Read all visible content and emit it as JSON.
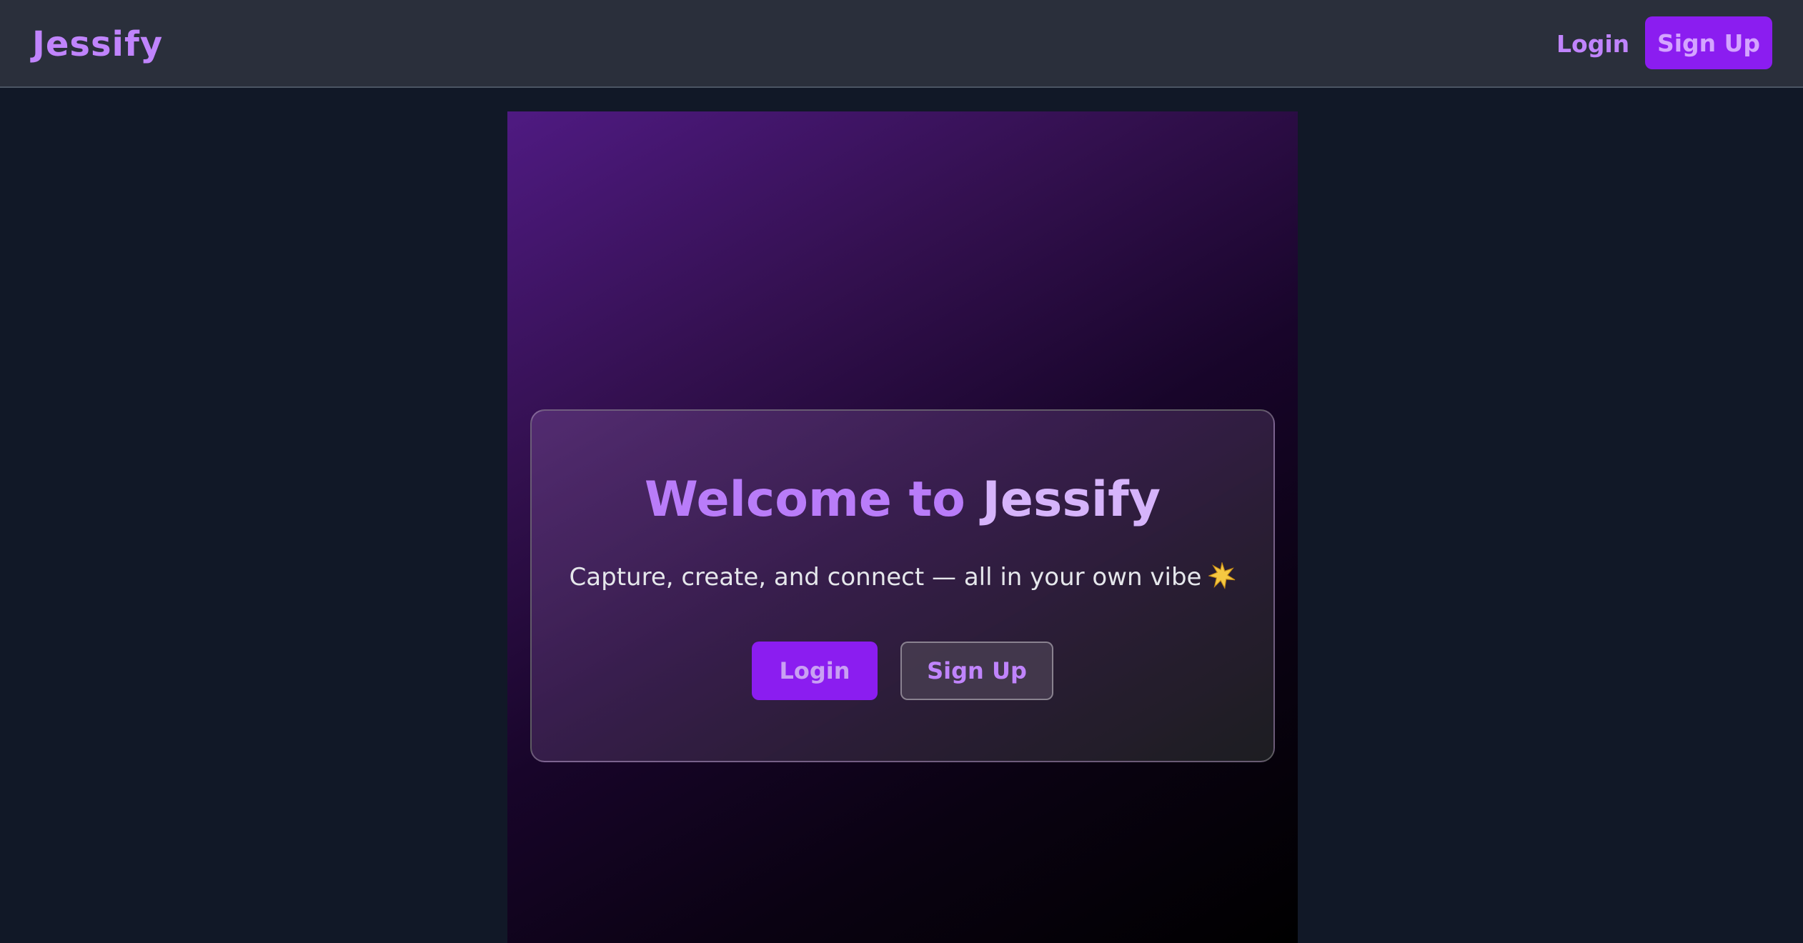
{
  "navbar": {
    "brand": "Jessify",
    "login_label": "Login",
    "signup_label": "Sign Up"
  },
  "hero": {
    "title_part1": "Welcome to",
    "title_part2": "Jessify",
    "tagline": "Capture, create, and connect — all in your own vibe",
    "tagline_icon": "sparkle-star-icon",
    "login_label": "Login",
    "signup_label": "Sign Up"
  },
  "colors": {
    "page_background": "#111827",
    "navbar_background": "#2a2f3b",
    "accent": "#8b1df0",
    "accent_text": "#c084fc",
    "panel_gradient_start": "#4f1a82",
    "panel_gradient_end": "#000000"
  }
}
